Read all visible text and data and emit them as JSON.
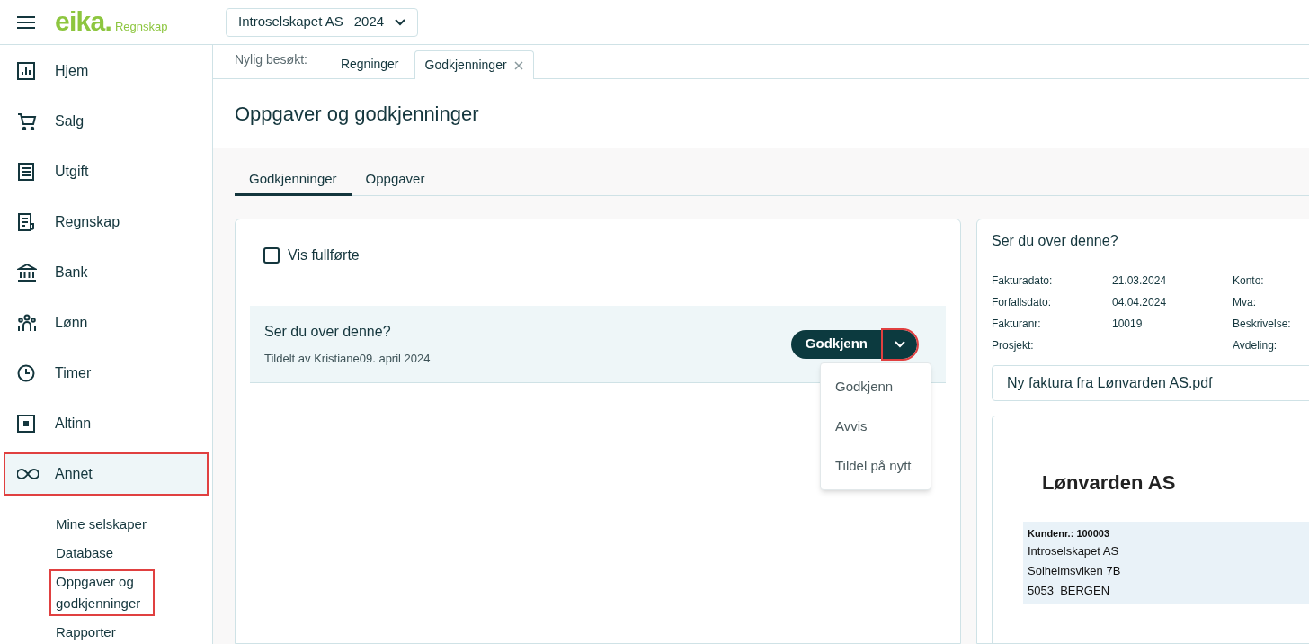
{
  "header": {
    "logo": {
      "brand": "eika.",
      "product": "Regnskap"
    },
    "company_selector": {
      "company": "Introselskapet AS",
      "year": "2024"
    }
  },
  "sidebar": {
    "items": [
      {
        "label": "Hjem",
        "selected": false,
        "highlighted": false
      },
      {
        "label": "Salg",
        "selected": false,
        "highlighted": false
      },
      {
        "label": "Utgift",
        "selected": false,
        "highlighted": false
      },
      {
        "label": "Regnskap",
        "selected": false,
        "highlighted": false
      },
      {
        "label": "Bank",
        "selected": false,
        "highlighted": false
      },
      {
        "label": "Lønn",
        "selected": false,
        "highlighted": false
      },
      {
        "label": "Timer",
        "selected": false,
        "highlighted": false
      },
      {
        "label": "Altinn",
        "selected": false,
        "highlighted": false
      },
      {
        "label": "Annet",
        "selected": true,
        "highlighted": true,
        "children": [
          {
            "label": "Mine selskaper",
            "highlighted": false
          },
          {
            "label": "Database",
            "highlighted": false
          },
          {
            "label": "Oppgaver og godkjenninger",
            "highlighted": true
          },
          {
            "label": "Rapporter",
            "highlighted": false
          }
        ]
      }
    ]
  },
  "recent": {
    "label": "Nylig besøkt:",
    "tabs": [
      {
        "label": "Regninger",
        "selected": false
      },
      {
        "label": "Godkjenninger",
        "selected": true
      }
    ]
  },
  "page_title": "Oppgaver og godkjenninger",
  "tabs": [
    {
      "label": "Godkjenninger",
      "selected": true
    },
    {
      "label": "Oppgaver",
      "selected": false
    }
  ],
  "list": {
    "show_completed": {
      "label": "Vis fullførte",
      "checked": false
    },
    "tasks": [
      {
        "title": "Ser du over denne?",
        "meta": "Tildelt av Kristiane09. april 2024",
        "action": "Godkjenn",
        "toggle_highlighted": true,
        "menu_open": true,
        "menu": [
          "Godkjenn",
          "Avvis",
          "Tildel på nytt"
        ]
      }
    ]
  },
  "detail": {
    "title": "Ser du over denne?",
    "fields": [
      {
        "label": "Fakturadato:",
        "value": "21.03.2024"
      },
      {
        "label": "Konto:"
      },
      {
        "label": "Forfallsdato:",
        "value": "04.04.2024"
      },
      {
        "label": "Mva:"
      },
      {
        "label": "Fakturanr:",
        "value": "10019"
      },
      {
        "label": "Beskrivelse:"
      },
      {
        "label": "Prosjekt:"
      },
      {
        "label": "Avdeling:"
      }
    ],
    "attachment": "Ny faktura fra Lønvarden AS.pdf",
    "document": {
      "company": "Lønvarden AS",
      "customer_no": "Kundenr.: 100003",
      "address": [
        "Introselskapet AS",
        "Solheimsviken 7B",
        "5053  BERGEN"
      ]
    }
  }
}
